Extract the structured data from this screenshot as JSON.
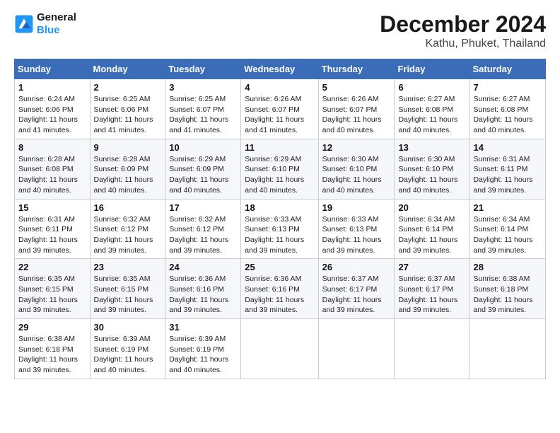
{
  "header": {
    "logo_line1": "General",
    "logo_line2": "Blue",
    "month_title": "December 2024",
    "location": "Kathu, Phuket, Thailand"
  },
  "weekdays": [
    "Sunday",
    "Monday",
    "Tuesday",
    "Wednesday",
    "Thursday",
    "Friday",
    "Saturday"
  ],
  "weeks": [
    [
      {
        "day": "1",
        "info": "Sunrise: 6:24 AM\nSunset: 6:06 PM\nDaylight: 11 hours and 41 minutes."
      },
      {
        "day": "2",
        "info": "Sunrise: 6:25 AM\nSunset: 6:06 PM\nDaylight: 11 hours and 41 minutes."
      },
      {
        "day": "3",
        "info": "Sunrise: 6:25 AM\nSunset: 6:07 PM\nDaylight: 11 hours and 41 minutes."
      },
      {
        "day": "4",
        "info": "Sunrise: 6:26 AM\nSunset: 6:07 PM\nDaylight: 11 hours and 41 minutes."
      },
      {
        "day": "5",
        "info": "Sunrise: 6:26 AM\nSunset: 6:07 PM\nDaylight: 11 hours and 40 minutes."
      },
      {
        "day": "6",
        "info": "Sunrise: 6:27 AM\nSunset: 6:08 PM\nDaylight: 11 hours and 40 minutes."
      },
      {
        "day": "7",
        "info": "Sunrise: 6:27 AM\nSunset: 6:08 PM\nDaylight: 11 hours and 40 minutes."
      }
    ],
    [
      {
        "day": "8",
        "info": "Sunrise: 6:28 AM\nSunset: 6:08 PM\nDaylight: 11 hours and 40 minutes."
      },
      {
        "day": "9",
        "info": "Sunrise: 6:28 AM\nSunset: 6:09 PM\nDaylight: 11 hours and 40 minutes."
      },
      {
        "day": "10",
        "info": "Sunrise: 6:29 AM\nSunset: 6:09 PM\nDaylight: 11 hours and 40 minutes."
      },
      {
        "day": "11",
        "info": "Sunrise: 6:29 AM\nSunset: 6:10 PM\nDaylight: 11 hours and 40 minutes."
      },
      {
        "day": "12",
        "info": "Sunrise: 6:30 AM\nSunset: 6:10 PM\nDaylight: 11 hours and 40 minutes."
      },
      {
        "day": "13",
        "info": "Sunrise: 6:30 AM\nSunset: 6:10 PM\nDaylight: 11 hours and 40 minutes."
      },
      {
        "day": "14",
        "info": "Sunrise: 6:31 AM\nSunset: 6:11 PM\nDaylight: 11 hours and 39 minutes."
      }
    ],
    [
      {
        "day": "15",
        "info": "Sunrise: 6:31 AM\nSunset: 6:11 PM\nDaylight: 11 hours and 39 minutes."
      },
      {
        "day": "16",
        "info": "Sunrise: 6:32 AM\nSunset: 6:12 PM\nDaylight: 11 hours and 39 minutes."
      },
      {
        "day": "17",
        "info": "Sunrise: 6:32 AM\nSunset: 6:12 PM\nDaylight: 11 hours and 39 minutes."
      },
      {
        "day": "18",
        "info": "Sunrise: 6:33 AM\nSunset: 6:13 PM\nDaylight: 11 hours and 39 minutes."
      },
      {
        "day": "19",
        "info": "Sunrise: 6:33 AM\nSunset: 6:13 PM\nDaylight: 11 hours and 39 minutes."
      },
      {
        "day": "20",
        "info": "Sunrise: 6:34 AM\nSunset: 6:14 PM\nDaylight: 11 hours and 39 minutes."
      },
      {
        "day": "21",
        "info": "Sunrise: 6:34 AM\nSunset: 6:14 PM\nDaylight: 11 hours and 39 minutes."
      }
    ],
    [
      {
        "day": "22",
        "info": "Sunrise: 6:35 AM\nSunset: 6:15 PM\nDaylight: 11 hours and 39 minutes."
      },
      {
        "day": "23",
        "info": "Sunrise: 6:35 AM\nSunset: 6:15 PM\nDaylight: 11 hours and 39 minutes."
      },
      {
        "day": "24",
        "info": "Sunrise: 6:36 AM\nSunset: 6:16 PM\nDaylight: 11 hours and 39 minutes."
      },
      {
        "day": "25",
        "info": "Sunrise: 6:36 AM\nSunset: 6:16 PM\nDaylight: 11 hours and 39 minutes."
      },
      {
        "day": "26",
        "info": "Sunrise: 6:37 AM\nSunset: 6:17 PM\nDaylight: 11 hours and 39 minutes."
      },
      {
        "day": "27",
        "info": "Sunrise: 6:37 AM\nSunset: 6:17 PM\nDaylight: 11 hours and 39 minutes."
      },
      {
        "day": "28",
        "info": "Sunrise: 6:38 AM\nSunset: 6:18 PM\nDaylight: 11 hours and 39 minutes."
      }
    ],
    [
      {
        "day": "29",
        "info": "Sunrise: 6:38 AM\nSunset: 6:18 PM\nDaylight: 11 hours and 39 minutes."
      },
      {
        "day": "30",
        "info": "Sunrise: 6:39 AM\nSunset: 6:19 PM\nDaylight: 11 hours and 40 minutes."
      },
      {
        "day": "31",
        "info": "Sunrise: 6:39 AM\nSunset: 6:19 PM\nDaylight: 11 hours and 40 minutes."
      },
      null,
      null,
      null,
      null
    ]
  ]
}
